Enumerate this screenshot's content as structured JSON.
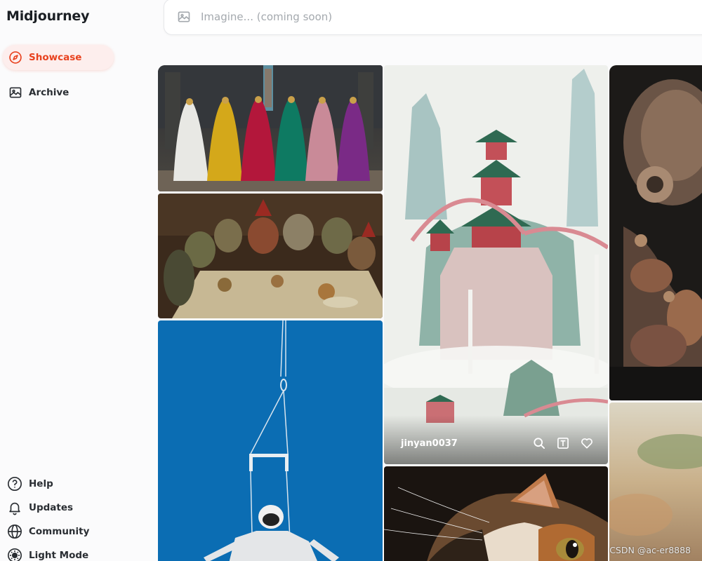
{
  "brand": "Midjourney",
  "nav": {
    "showcase": "Showcase",
    "archive": "Archive"
  },
  "bottom_nav": {
    "help": "Help",
    "updates": "Updates",
    "community": "Community",
    "light_mode": "Light Mode"
  },
  "search": {
    "placeholder": "Imagine... (coming soon)",
    "icon": "image-icon"
  },
  "gallery": {
    "featured_author": "jinyan0037",
    "tiles": [
      {
        "subject": "colorful robed figures"
      },
      {
        "subject": "goblin feast painting"
      },
      {
        "subject": "astronaut on trapeze"
      },
      {
        "subject": "chinese pagoda landscape"
      },
      {
        "subject": "calico cat close-up"
      },
      {
        "subject": "bronze octopus sculpture"
      },
      {
        "subject": "blurred beach"
      }
    ]
  },
  "watermark": "CSDN @ac-er8888",
  "colors": {
    "accent": "#e8421f",
    "active_bg": "#fdeeed"
  }
}
